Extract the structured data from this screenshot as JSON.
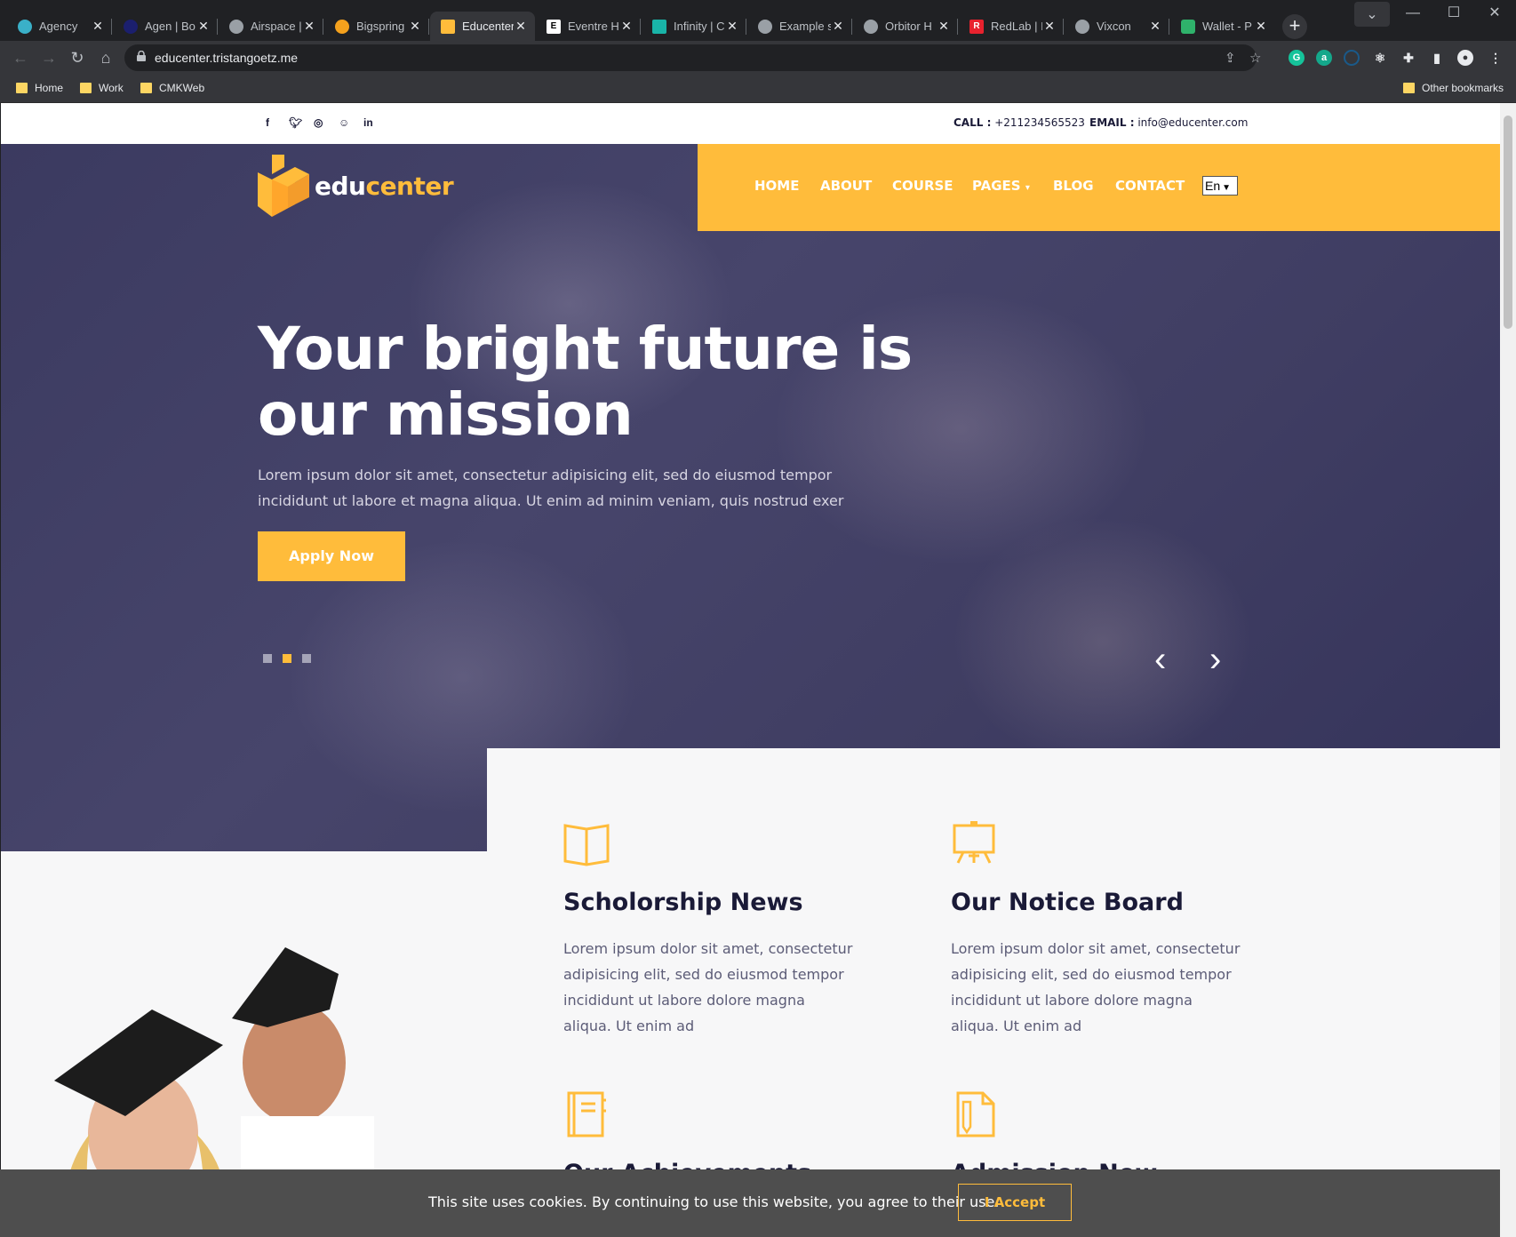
{
  "browser": {
    "tabs": [
      {
        "title": "Agency",
        "color": "#3ab0c8",
        "glyph": ""
      },
      {
        "title": "Agen | Bo",
        "color": "#1b1f6e",
        "glyph": ""
      },
      {
        "title": "Airspace |",
        "color": "#5f6368",
        "glyph": ""
      },
      {
        "title": "Bigspring",
        "color": "#f4a11d",
        "glyph": ""
      },
      {
        "title": "Educenter",
        "color": "#ffbc3b",
        "glyph": ""
      },
      {
        "title": "Eventre H",
        "color": "#ffffff",
        "glyph": "E"
      },
      {
        "title": "Infinity | C",
        "color": "#19b4a8",
        "glyph": ""
      },
      {
        "title": "Example s",
        "color": "#5f6368",
        "glyph": ""
      },
      {
        "title": "Orbitor H",
        "color": "#5f6368",
        "glyph": ""
      },
      {
        "title": "RedLab | I",
        "color": "#e8222e",
        "glyph": "R"
      },
      {
        "title": "Vixcon",
        "color": "#5f6368",
        "glyph": ""
      },
      {
        "title": "Wallet - P",
        "color": "#2fb26b",
        "glyph": ""
      }
    ],
    "url": "educenter.tristangoetz.me",
    "bookmarks": [
      "Home",
      "Work",
      "CMKWeb"
    ],
    "other_bookmarks": "Other bookmarks"
  },
  "site": {
    "call_label": "CALL :",
    "phone": "+211234565523",
    "email_label": "EMAIL :",
    "email": "info@educenter.com",
    "logo_a": "edu",
    "logo_b": "center",
    "nav": [
      "HOME",
      "ABOUT",
      "COURSE",
      "PAGES",
      "BLOG",
      "CONTACT"
    ],
    "lang": "En",
    "hero_title": "Your bright future is our mission",
    "hero_text": "Lorem ipsum dolor sit amet, consectetur adipisicing elit, sed do eiusmod tempor incididunt ut labore et magna aliqua. Ut enim ad minim veniam, quis nostrud exer",
    "apply": "Apply Now",
    "features": [
      {
        "title": "Scholorship News",
        "text": "Lorem ipsum dolor sit amet, consectetur adipisicing elit, sed do eiusmod tempor incididunt ut labore dolore magna aliqua. Ut enim ad",
        "icon": "book-icon"
      },
      {
        "title": "Our Notice Board",
        "text": "Lorem ipsum dolor sit amet, consectetur adipisicing elit, sed do eiusmod tempor incididunt ut labore dolore magna aliqua. Ut enim ad",
        "icon": "board-icon"
      },
      {
        "title": "Our Achievements",
        "icon": "notebook-icon"
      },
      {
        "title": "Admission Now",
        "icon": "document-icon"
      }
    ],
    "cookie_text": "This site uses cookies. By continuing to use this website, you agree to their use.",
    "cookie_accept": "I Accept",
    "accent": "#ffbc3b",
    "navy": "#1a1a37"
  }
}
